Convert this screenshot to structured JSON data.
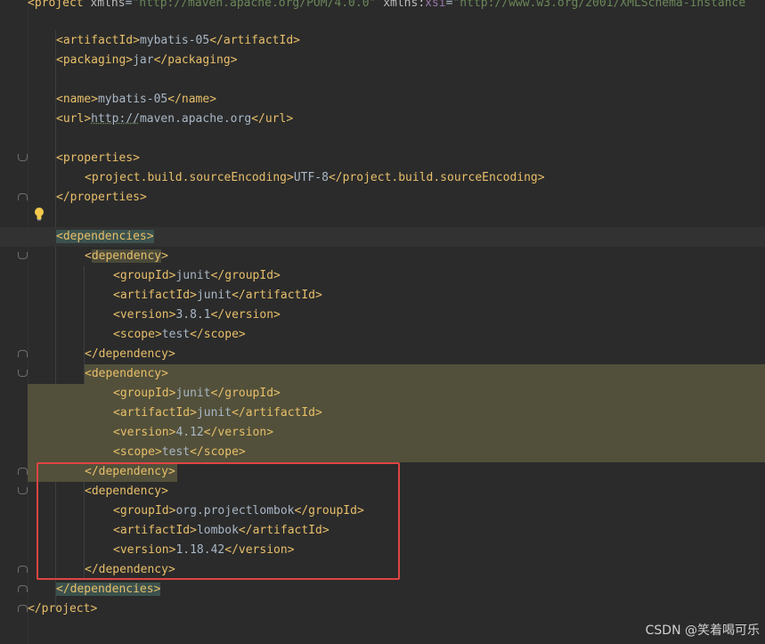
{
  "editor": {
    "lines": {
      "project_open": {
        "tag": "project",
        "xmlns_attr": "xmlns",
        "xmlns_val": "\"http://maven.apache.org/POM/4.0.0\"",
        "xsi_ns": "xmlns:",
        "xsi_attr": "xsi",
        "xsi_val": "\"http://www.w3.org/2001/XMLSchema-instance"
      },
      "artifactId_top": {
        "open": "artifactId",
        "value": "mybatis-05",
        "close": "artifactId"
      },
      "packaging": {
        "open": "packaging",
        "value": "jar",
        "close": "packaging"
      },
      "name": {
        "open": "name",
        "value": "mybatis-05",
        "close": "name"
      },
      "url": {
        "open": "url",
        "value_link": "http://",
        "value_rest": "maven.apache.org",
        "close": "url"
      },
      "properties_open": "properties",
      "source_encoding": {
        "open": "project.build.sourceEncoding",
        "value": "UTF-8",
        "close": "project.build.sourceEncoding"
      },
      "properties_close": "properties",
      "dependencies_open": "dependencies",
      "dep1_open": "dependency",
      "dep1_group": {
        "open": "groupId",
        "value": "junit",
        "close": "groupId"
      },
      "dep1_artifact": {
        "open": "artifactId",
        "value": "junit",
        "close": "artifactId"
      },
      "dep1_version": {
        "open": "version",
        "value": "3.8.1",
        "close": "version"
      },
      "dep1_scope": {
        "open": "scope",
        "value": "test",
        "close": "scope"
      },
      "dep1_close": "dependency",
      "dep2_open": "dependency",
      "dep2_group": {
        "open": "groupId",
        "value": "junit",
        "close": "groupId"
      },
      "dep2_artifact": {
        "open": "artifactId",
        "value": "junit",
        "close": "artifactId"
      },
      "dep2_version": {
        "open": "version",
        "value": "4.12",
        "close": "version"
      },
      "dep2_scope": {
        "open": "scope",
        "value": "test",
        "close": "scope"
      },
      "dep2_close": "dependency",
      "dep3_open": "dependency",
      "dep3_group": {
        "open": "groupId",
        "value": "org.projectlombok",
        "close": "groupId"
      },
      "dep3_artifact": {
        "open": "artifactId",
        "value": "lombok",
        "close": "artifactId"
      },
      "dep3_version": {
        "open": "version",
        "value": "1.18.42",
        "close": "version"
      },
      "dep3_close": "dependency",
      "dependencies_close": "dependencies",
      "project_close": "project"
    }
  },
  "colors": {
    "background": "#2b2b2b",
    "tag": "#e8bf6a",
    "text": "#a9b7c6",
    "string": "#6a8759",
    "highlight": "#52503a",
    "annotation_box": "#e04343"
  },
  "watermark": "CSDN @笑着喝可乐"
}
